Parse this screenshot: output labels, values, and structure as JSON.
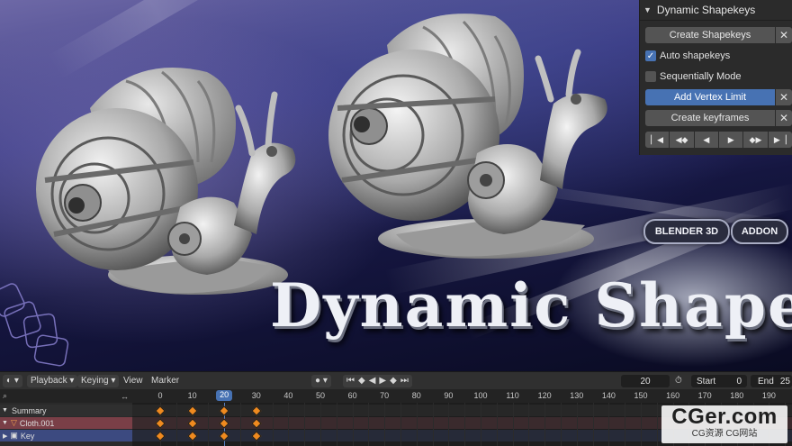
{
  "panel": {
    "title": "Dynamic Shapekeys",
    "create_shapekeys": "Create Shapekeys",
    "auto_shapekeys": "Auto shapekeys",
    "auto_checked": true,
    "sequentially_mode": "Sequentially Mode",
    "sequential_checked": false,
    "add_vertex_limit": "Add Vertex Limit",
    "create_keyframes": "Create keyframes",
    "close_glyph": "✕"
  },
  "banner": {
    "title": "Dynamic  Shapekeys",
    "badge_left": "BLENDER 3D",
    "badge_right": "ADDON"
  },
  "timeline": {
    "menu_playback": "Playback",
    "menu_keying": "Keying",
    "menu_view": "View",
    "menu_marker": "Marker",
    "current_frame": "20",
    "start_label": "Start",
    "start_value": "0",
    "end_label": "End",
    "end_value": "25",
    "ruler_ticks": [
      "0",
      "10",
      "20",
      "30",
      "40",
      "50",
      "60",
      "70",
      "80",
      "90",
      "100",
      "110",
      "120",
      "130",
      "140",
      "150",
      "160",
      "170",
      "180",
      "190"
    ],
    "tracks": [
      "Summary",
      "Cloth.001",
      "Key"
    ],
    "keyframes": [
      0,
      10,
      20,
      30
    ]
  },
  "watermark": {
    "main": "CGer.com",
    "sub": "CG资源 CG网站"
  },
  "colors": {
    "accent_blue": "#4772b3",
    "keyframe_orange": "#ef8a1f",
    "panel_bg": "#2b2b2b"
  },
  "icons": {
    "editor_type": "clock-icon",
    "nav": [
      "jump-start-icon",
      "prev-keyframe-icon",
      "play-reverse-icon",
      "play-icon",
      "next-keyframe-icon",
      "jump-end-icon"
    ]
  }
}
